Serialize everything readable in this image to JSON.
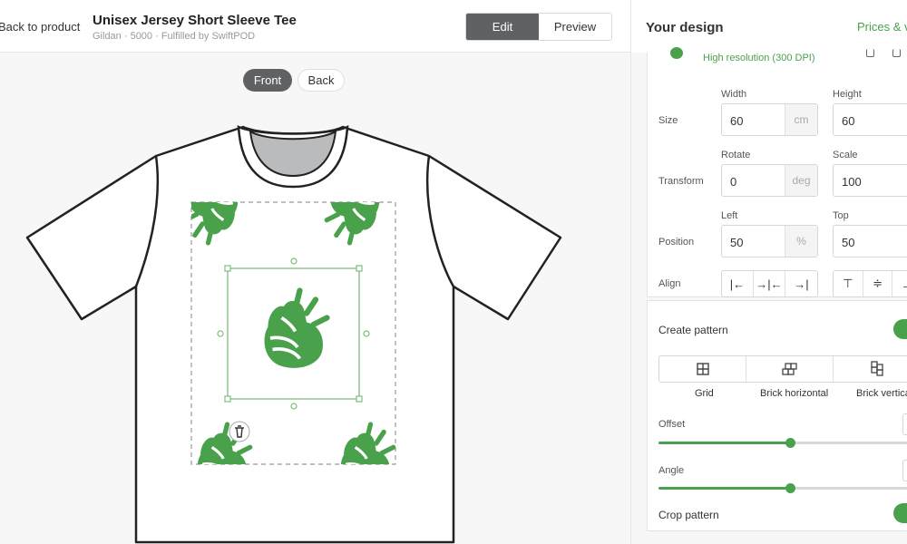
{
  "header": {
    "back_link": "Back to product",
    "title": "Unisex Jersey Short Sleeve Tee",
    "subtitle": "Gildan · 5000 · Fulfilled by SwiftPOD",
    "edit_label": "Edit",
    "preview_label": "Preview"
  },
  "canvas": {
    "front_label": "Front",
    "back_label": "Back",
    "shirt_color": "#ffffff",
    "design_color": "#4aa14b"
  },
  "panel": {
    "title": "Your design",
    "prices_link": "Prices & va",
    "resolution": "High resolution (300 DPI)",
    "size": {
      "label": "Size",
      "width_label": "Width",
      "width_value": "60",
      "width_unit": "cm",
      "height_label": "Height",
      "height_value": "60",
      "height_unit": "c"
    },
    "transform": {
      "label": "Transform",
      "rotate_label": "Rotate",
      "rotate_value": "0",
      "rotate_unit": "deg",
      "scale_label": "Scale",
      "scale_value": "100",
      "scale_unit": "%"
    },
    "position": {
      "label": "Position",
      "left_label": "Left",
      "left_value": "50",
      "left_unit": "%",
      "top_label": "Top",
      "top_value": "50"
    },
    "align": {
      "label": "Align",
      "h_icons": [
        "|←",
        "→|←",
        "→|"
      ],
      "v_icons": [
        "⊤",
        "≑",
        "⊥"
      ]
    },
    "pattern": {
      "create_label": "Create pattern",
      "create_on": true,
      "tabs": [
        {
          "label": "Grid",
          "icon": "grid-icon"
        },
        {
          "label": "Brick horizontal",
          "icon": "brick-horizontal-icon"
        },
        {
          "label": "Brick vertica",
          "icon": "brick-vertical-icon"
        }
      ],
      "offset_label": "Offset",
      "offset_value": 0.5,
      "angle_label": "Angle",
      "angle_value": 0.5,
      "crop_label": "Crop pattern",
      "crop_on": true
    }
  }
}
